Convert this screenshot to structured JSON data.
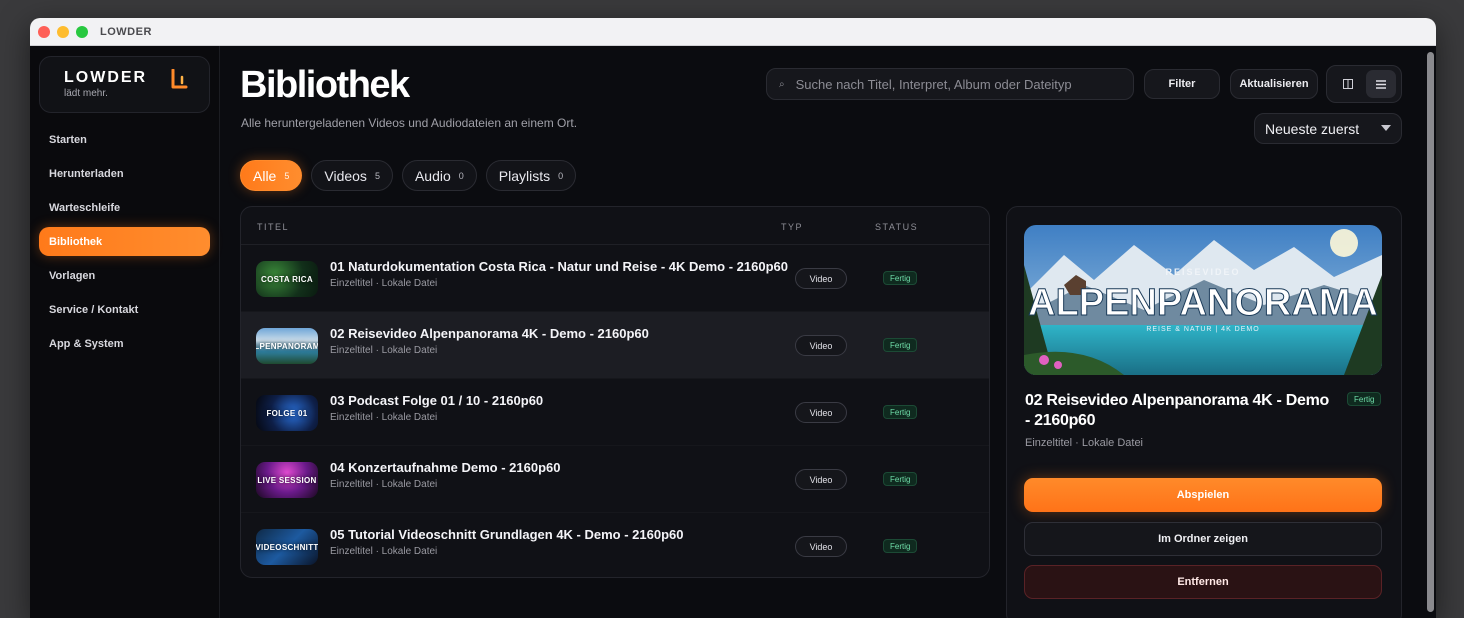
{
  "window": {
    "title": "LOWDER"
  },
  "sidebar": {
    "logo": {
      "name": "LOWDER",
      "tagline": "lädt mehr."
    },
    "items": [
      {
        "label": "Starten"
      },
      {
        "label": "Herunterladen"
      },
      {
        "label": "Warteschleife"
      },
      {
        "label": "Bibliothek",
        "active": true
      },
      {
        "label": "Vorlagen"
      },
      {
        "label": "Service / Kontakt"
      },
      {
        "label": "App & System"
      }
    ]
  },
  "header": {
    "title": "Bibliothek",
    "subtitle": "Alle heruntergeladenen Videos und Audiodateien an einem Ort.",
    "search_placeholder": "Suche nach Titel, Interpret, Album oder Dateityp",
    "filter_label": "Filter",
    "refresh_label": "Aktualisieren",
    "sort_label": "Neueste zuerst"
  },
  "chips": [
    {
      "label": "Alle",
      "count": "5",
      "active": true
    },
    {
      "label": "Videos",
      "count": "5"
    },
    {
      "label": "Audio",
      "count": "0"
    },
    {
      "label": "Playlists",
      "count": "0"
    }
  ],
  "table": {
    "columns": {
      "title": "TITEL",
      "type": "TYP",
      "status": "STATUS"
    },
    "rows": [
      {
        "title": "01 Naturdokumentation Costa Rica - Natur und Reise - 4K Demo - 2160p60",
        "meta": "Einzeltitel · Lokale Datei",
        "type": "Video",
        "status": "Fertig",
        "thumb": "COSTA RICA"
      },
      {
        "title": "02 Reisevideo Alpenpanorama 4K - Demo - 2160p60",
        "meta": "Einzeltitel · Lokale Datei",
        "type": "Video",
        "status": "Fertig",
        "thumb": "ALPENPANORAMA",
        "selected": true
      },
      {
        "title": "03 Podcast Folge 01 / 10 - 2160p60",
        "meta": "Einzeltitel · Lokale Datei",
        "type": "Video",
        "status": "Fertig",
        "thumb": "FOLGE 01"
      },
      {
        "title": "04 Konzertaufnahme Demo - 2160p60",
        "meta": "Einzeltitel · Lokale Datei",
        "type": "Video",
        "status": "Fertig",
        "thumb": "LIVE SESSION"
      },
      {
        "title": "05 Tutorial Videoschnitt Grundlagen 4K - Demo - 2160p60",
        "meta": "Einzeltitel · Lokale Datei",
        "type": "Video",
        "status": "Fertig",
        "thumb": "VIDEOSCHNITT"
      }
    ]
  },
  "detail": {
    "preview": {
      "kicker": "REISEVIDEO",
      "headline": "ALPENPANORAMA",
      "tagline": "REISE & NATUR | 4K DEMO"
    },
    "title": "02 Reisevideo Alpenpanorama 4K - Demo - 2160p60",
    "status": "Fertig",
    "meta": "Einzeltitel · Lokale Datei",
    "play_label": "Abspielen",
    "folder_label": "Im Ordner zeigen",
    "remove_label": "Entfernen"
  },
  "colors": {
    "accent": "#ff7a1a",
    "status_ok": "#6fdca8",
    "danger": "#5a2226"
  },
  "icons": {
    "search": "search-icon",
    "grid": "grid-view-icon",
    "list": "list-view-icon",
    "sort": "chevron-down-icon"
  }
}
